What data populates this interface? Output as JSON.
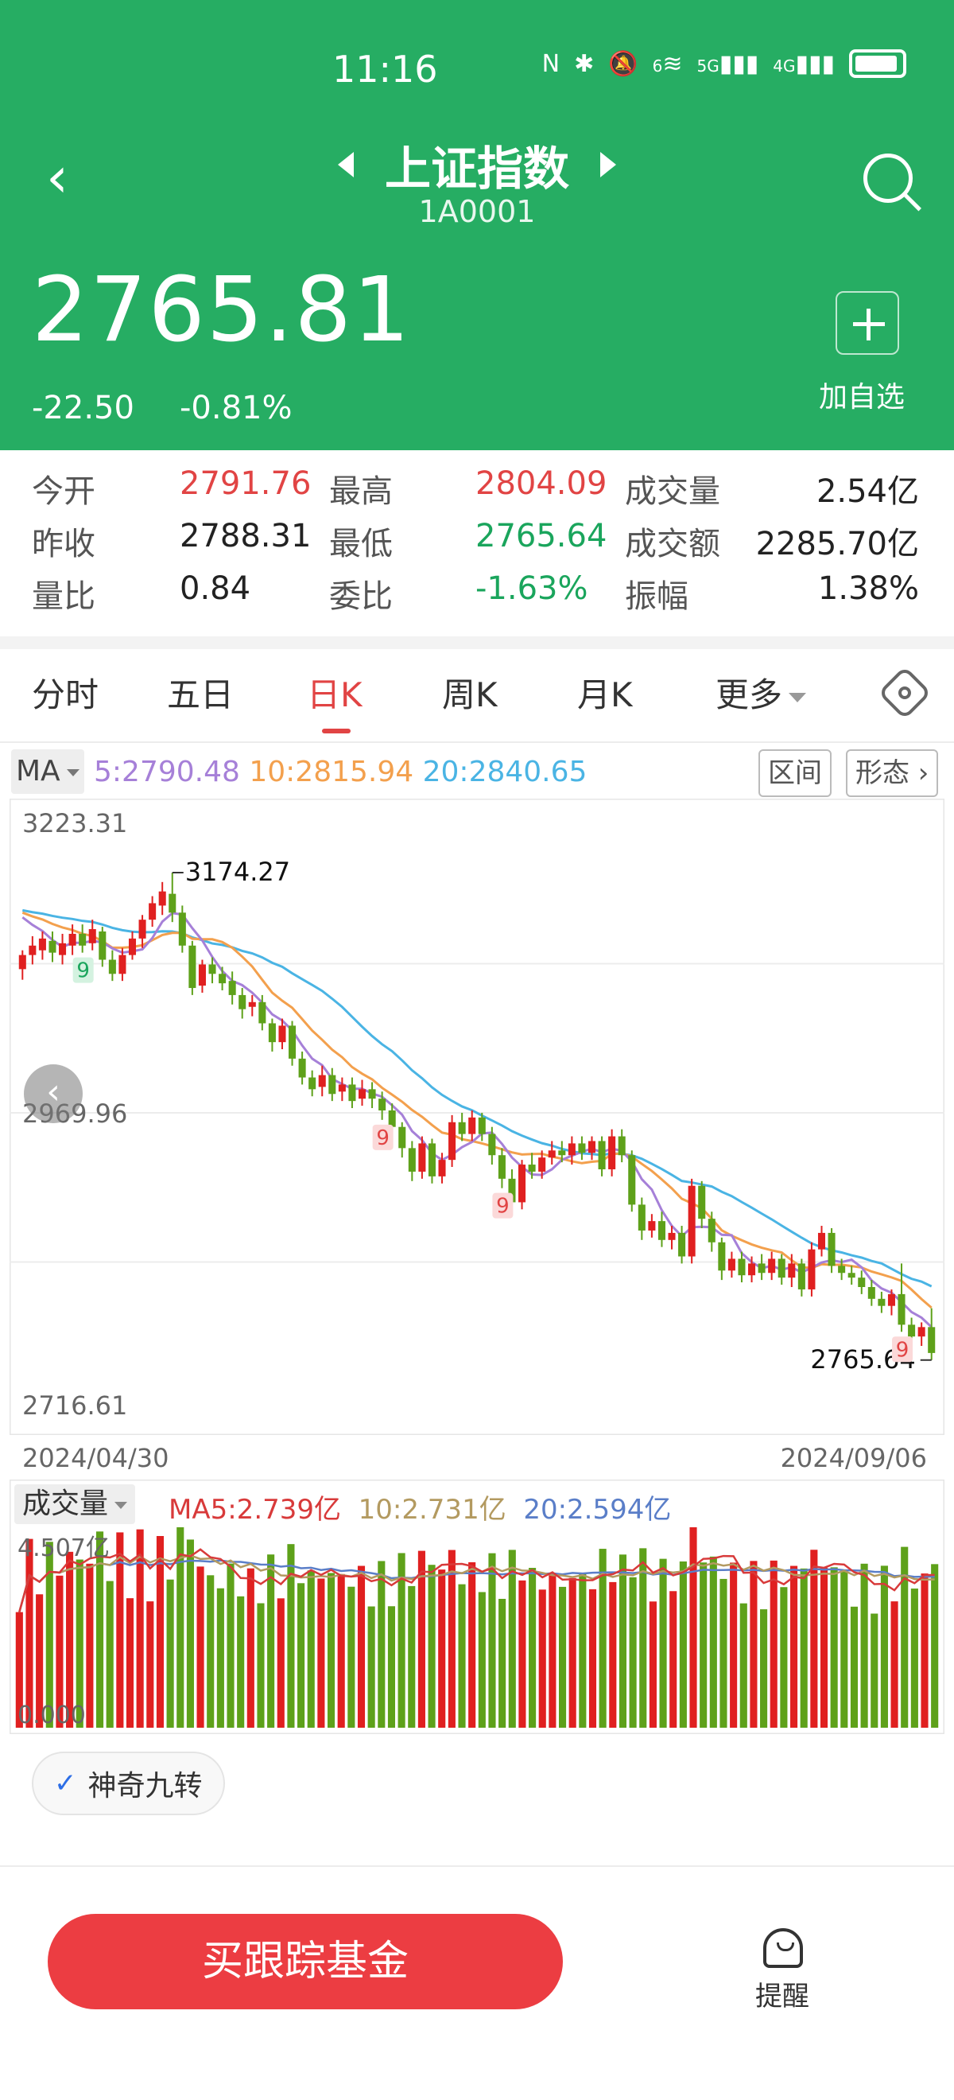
{
  "status_bar": {
    "time": "11:16",
    "icons": [
      "nfc-icon",
      "bluetooth-icon",
      "mute-icon",
      "wifi-icon",
      "5g-signal-icon",
      "4g-signal-icon",
      "battery-icon"
    ],
    "labels": {
      "wifi": "6",
      "net1": "5G",
      "net2": "4G"
    }
  },
  "header": {
    "title": "上证指数",
    "code": "1A0001",
    "price": "2765.81",
    "change": "-22.50",
    "change_pct": "-0.81%",
    "add_label": "加自选",
    "bg_color": "#26ad63"
  },
  "stats": {
    "open_label": "今开",
    "open_value": "2791.76",
    "high_label": "最高",
    "high_value": "2804.09",
    "volume_label": "成交量",
    "volume_value": "2.54亿",
    "prev_close_label": "昨收",
    "prev_close_value": "2788.31",
    "low_label": "最低",
    "low_value": "2765.64",
    "amount_label": "成交额",
    "amount_value": "2285.70亿",
    "vol_ratio_label": "量比",
    "vol_ratio_value": "0.84",
    "commission_label": "委比",
    "commission_value": "-1.63%",
    "amplitude_label": "振幅",
    "amplitude_value": "1.38%"
  },
  "tabs": [
    {
      "label": "分时",
      "active": false
    },
    {
      "label": "五日",
      "active": false
    },
    {
      "label": "日K",
      "active": true
    },
    {
      "label": "周K",
      "active": false
    },
    {
      "label": "月K",
      "active": false
    },
    {
      "label": "更多",
      "active": false
    }
  ],
  "ma": {
    "button": "MA",
    "ma5": "5:2790.48",
    "ma10": "10:2815.94",
    "ma20": "20:2840.65",
    "range_btn": "区间",
    "pattern_btn": "形态"
  },
  "chart_data": {
    "type": "candlestick",
    "ylim": [
      2716.61,
      3223.31
    ],
    "y_ticks": [
      "3223.31",
      "2969.96",
      "2716.61"
    ],
    "x_start": "2024/04/30",
    "x_end": "2024/09/06",
    "max_label": "3174.27",
    "min_label": "2765.64",
    "ma_colors": {
      "ma5": "#a680d8",
      "ma10": "#f3a04d",
      "ma20": "#4ab4e4"
    },
    "up_color": "#e02020",
    "down_color": "#5ea11a",
    "sequential_marks": [
      {
        "text": "9",
        "color": "green"
      },
      {
        "text": "9",
        "color": "red"
      },
      {
        "text": "9",
        "color": "red"
      },
      {
        "text": "9",
        "color": "red"
      }
    ],
    "candles": [
      [
        3092,
        3104,
        3083,
        3108
      ],
      [
        3104,
        3112,
        3096,
        3120
      ],
      [
        3108,
        3118,
        3100,
        3124
      ],
      [
        3116,
        3106,
        3098,
        3124
      ],
      [
        3104,
        3114,
        3096,
        3122
      ],
      [
        3112,
        3122,
        3104,
        3130
      ],
      [
        3122,
        3112,
        3106,
        3130
      ],
      [
        3114,
        3126,
        3108,
        3134
      ],
      [
        3124,
        3100,
        3094,
        3128
      ],
      [
        3100,
        3088,
        3082,
        3108
      ],
      [
        3088,
        3104,
        3082,
        3110
      ],
      [
        3104,
        3118,
        3100,
        3124
      ],
      [
        3118,
        3134,
        3110,
        3138
      ],
      [
        3134,
        3148,
        3128,
        3154
      ],
      [
        3146,
        3158,
        3138,
        3166
      ],
      [
        3156,
        3140,
        3132,
        3174
      ],
      [
        3140,
        3112,
        3106,
        3146
      ],
      [
        3112,
        3076,
        3070,
        3116
      ],
      [
        3078,
        3096,
        3072,
        3100
      ],
      [
        3096,
        3088,
        3080,
        3102
      ],
      [
        3088,
        3080,
        3074,
        3094
      ],
      [
        3082,
        3070,
        3062,
        3090
      ],
      [
        3070,
        3058,
        3050,
        3076
      ],
      [
        3060,
        3064,
        3052,
        3070
      ],
      [
        3064,
        3046,
        3040,
        3070
      ],
      [
        3046,
        3030,
        3022,
        3050
      ],
      [
        3030,
        3044,
        3024,
        3050
      ],
      [
        3044,
        3016,
        3010,
        3048
      ],
      [
        3016,
        3000,
        2994,
        3022
      ],
      [
        3000,
        2990,
        2984,
        3006
      ],
      [
        2992,
        3002,
        2984,
        3010
      ],
      [
        3002,
        2986,
        2980,
        3008
      ],
      [
        2988,
        2994,
        2980,
        3000
      ],
      [
        2994,
        2980,
        2974,
        3000
      ],
      [
        2982,
        2990,
        2976,
        2998
      ],
      [
        2990,
        2982,
        2974,
        2996
      ],
      [
        2982,
        2972,
        2964,
        2988
      ],
      [
        2972,
        2958,
        2950,
        2978
      ],
      [
        2958,
        2940,
        2932,
        2962
      ],
      [
        2940,
        2920,
        2912,
        2946
      ],
      [
        2920,
        2944,
        2914,
        2950
      ],
      [
        2944,
        2916,
        2910,
        2948
      ],
      [
        2916,
        2930,
        2910,
        2936
      ],
      [
        2930,
        2962,
        2924,
        2968
      ],
      [
        2962,
        2952,
        2946,
        2970
      ],
      [
        2952,
        2966,
        2946,
        2972
      ],
      [
        2966,
        2952,
        2946,
        2970
      ],
      [
        2952,
        2934,
        2926,
        2958
      ],
      [
        2934,
        2914,
        2906,
        2940
      ],
      [
        2914,
        2894,
        2888,
        2922
      ],
      [
        2894,
        2926,
        2888,
        2930
      ],
      [
        2926,
        2920,
        2914,
        2936
      ],
      [
        2920,
        2932,
        2914,
        2938
      ],
      [
        2932,
        2938,
        2926,
        2946
      ],
      [
        2938,
        2934,
        2928,
        2946
      ],
      [
        2934,
        2944,
        2926,
        2950
      ],
      [
        2944,
        2936,
        2930,
        2950
      ],
      [
        2936,
        2946,
        2930,
        2950
      ],
      [
        2946,
        2922,
        2916,
        2950
      ],
      [
        2922,
        2950,
        2916,
        2956
      ],
      [
        2950,
        2934,
        2928,
        2956
      ],
      [
        2934,
        2892,
        2886,
        2938
      ],
      [
        2892,
        2870,
        2862,
        2898
      ],
      [
        2870,
        2878,
        2864,
        2884
      ],
      [
        2878,
        2862,
        2856,
        2886
      ],
      [
        2862,
        2868,
        2854,
        2874
      ],
      [
        2868,
        2848,
        2842,
        2874
      ],
      [
        2848,
        2908,
        2842,
        2914
      ],
      [
        2908,
        2880,
        2872,
        2912
      ],
      [
        2880,
        2860,
        2852,
        2886
      ],
      [
        2860,
        2836,
        2828,
        2864
      ],
      [
        2836,
        2846,
        2830,
        2852
      ],
      [
        2846,
        2832,
        2826,
        2852
      ],
      [
        2832,
        2842,
        2826,
        2848
      ],
      [
        2842,
        2834,
        2828,
        2850
      ],
      [
        2834,
        2846,
        2828,
        2852
      ],
      [
        2846,
        2830,
        2824,
        2850
      ],
      [
        2830,
        2842,
        2822,
        2850
      ],
      [
        2842,
        2820,
        2814,
        2846
      ],
      [
        2820,
        2854,
        2814,
        2860
      ],
      [
        2854,
        2868,
        2848,
        2874
      ],
      [
        2868,
        2840,
        2834,
        2872
      ],
      [
        2840,
        2834,
        2828,
        2846
      ],
      [
        2834,
        2830,
        2824,
        2840
      ],
      [
        2830,
        2822,
        2816,
        2836
      ],
      [
        2822,
        2812,
        2806,
        2828
      ],
      [
        2812,
        2806,
        2800,
        2818
      ],
      [
        2806,
        2816,
        2798,
        2820
      ],
      [
        2816,
        2790,
        2784,
        2842
      ],
      [
        2790,
        2780,
        2774,
        2796
      ],
      [
        2780,
        2788,
        2772,
        2792
      ],
      [
        2788,
        2766,
        2760,
        2804
      ]
    ],
    "volume": {
      "label": "成交量",
      "ma5": "MA5:2.739亿",
      "ma10": "10:2.731亿",
      "ma20": "20:2.594亿",
      "max": "4.507亿",
      "min": "0.000",
      "ylim": [
        0,
        4.507
      ]
    }
  },
  "magic": {
    "label": "神奇九转"
  },
  "bottom": {
    "buy_label": "买跟踪基金",
    "remind_label": "提醒"
  }
}
